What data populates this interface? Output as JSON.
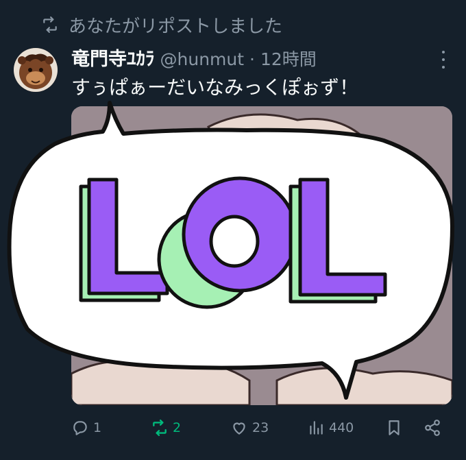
{
  "repost_banner": {
    "text": "あなたがリポストしました",
    "icon": "repost-icon"
  },
  "tweet": {
    "author_name": "竜門寺ﾕｶﾗ",
    "handle": "@hunmut",
    "separator": "·",
    "time": "12時間",
    "text": "すぅぱぁーだいなみっくぽぉず！",
    "media_text": "LOL"
  },
  "actions": {
    "reply_count": "1",
    "repost_count": "2",
    "like_count": "23",
    "views_count": "440"
  },
  "colors": {
    "background": "#15202b",
    "secondary_text": "#8b98a5",
    "repost_active": "#00ba7c",
    "lol_purple": "#9a5cf5",
    "lol_green": "#a6f0b4"
  }
}
